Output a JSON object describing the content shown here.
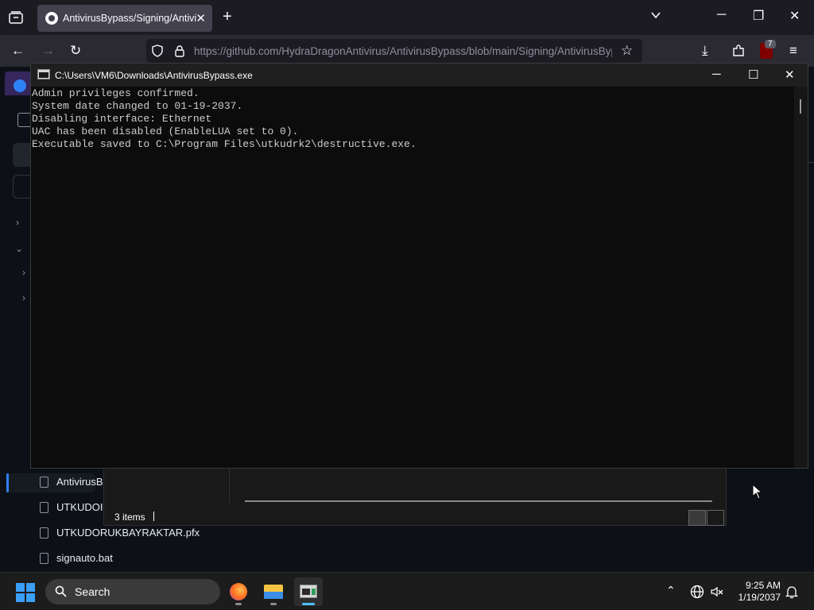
{
  "browser": {
    "tab_title": "AntivirusBypass/Signing/AntivirusBypass",
    "url": "https://github.com/HydraDragonAntivirus/AntivirusBypass/blob/main/Signing/AntivirusBypass",
    "extension_badge": "7"
  },
  "github": {
    "files": [
      {
        "name": "AntivirusB"
      },
      {
        "name": "UTKUDOI"
      },
      {
        "name": "UTKUDORUKBAYRAKTAR.pfx"
      },
      {
        "name": "signauto.bat"
      }
    ]
  },
  "explorer": {
    "items_count": "3 items"
  },
  "console": {
    "title": "C:\\Users\\VM6\\Downloads\\AntivirusBypass.exe",
    "lines": [
      "Admin privileges confirmed.",
      "System date changed to 01-19-2037.",
      "Disabling interface: Ethernet",
      "UAC has been disabled (EnableLUA set to 0).",
      "Executable saved to C:\\Program Files\\utkudrk2\\destructive.exe."
    ]
  },
  "taskbar": {
    "search_label": "Search",
    "time": "9:25 AM",
    "date": "1/19/2037"
  }
}
